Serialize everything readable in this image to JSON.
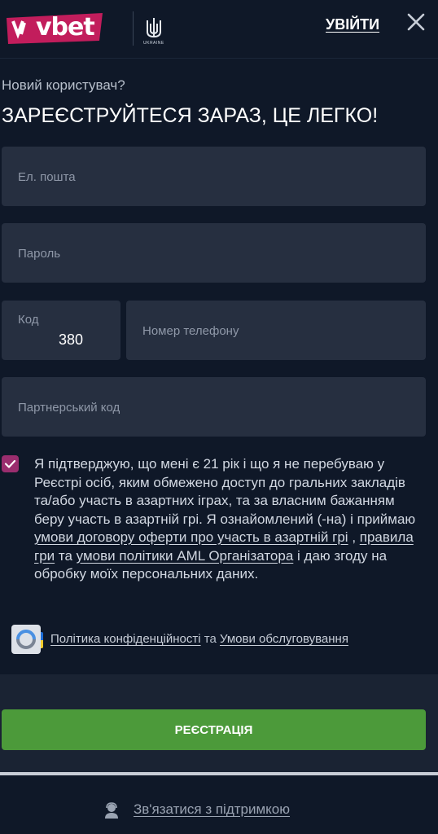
{
  "header": {
    "logo_text": "vbet",
    "emblem_text": "UKRAINE",
    "login_label": "УВІЙТИ"
  },
  "form": {
    "subtitle": "Новий користувач?",
    "title": "ЗАРЕЄСТРУЙТЕСЯ ЗАРАЗ, ЦЕ ЛЕГКО!",
    "email_placeholder": "Ел. пошта",
    "password_placeholder": "Пароль",
    "code_label": "Код",
    "code_value": "380",
    "phone_placeholder": "Номер телефону",
    "partner_placeholder": "Партнерський код"
  },
  "consent": {
    "checked": true,
    "text_1": "Я підтверджую, що мені є 21 рік і що я не перебуваю у Реєстрі осіб, яким обмежено доступ до гральних закладів та/або участь в азартних іграх, та за власним бажанням беру участь в азартній грі. Я ознайомлений (-на) і приймаю ",
    "link_offer": "умови договору оферти про участь в азартній грі",
    "text_2": " , ",
    "link_rules": "правила гри",
    "text_3": " та ",
    "link_aml": "умови політики AML Організатора",
    "text_4": " і даю згоду на обробку моїх персональних даних."
  },
  "policy": {
    "privacy_link": "Політика конфіденційності",
    "and": " та ",
    "terms_link": "Умови обслуговування"
  },
  "register_label": "РЕЄСТРАЦІЯ",
  "footer": {
    "support_label": "Зв'язатися з підтримкою"
  },
  "colors": {
    "background": "#0f1828",
    "field": "#262f40",
    "accent_checkbox": "#9a2d6e",
    "register_button": "#4c9a3a",
    "logo": "#c21d5c"
  },
  "icons": [
    "vbet-logo",
    "ukraine-emblem-icon",
    "close-icon",
    "ukraine-flag-icon",
    "checkmark-icon",
    "recaptcha-icon",
    "support-agent-icon"
  ]
}
